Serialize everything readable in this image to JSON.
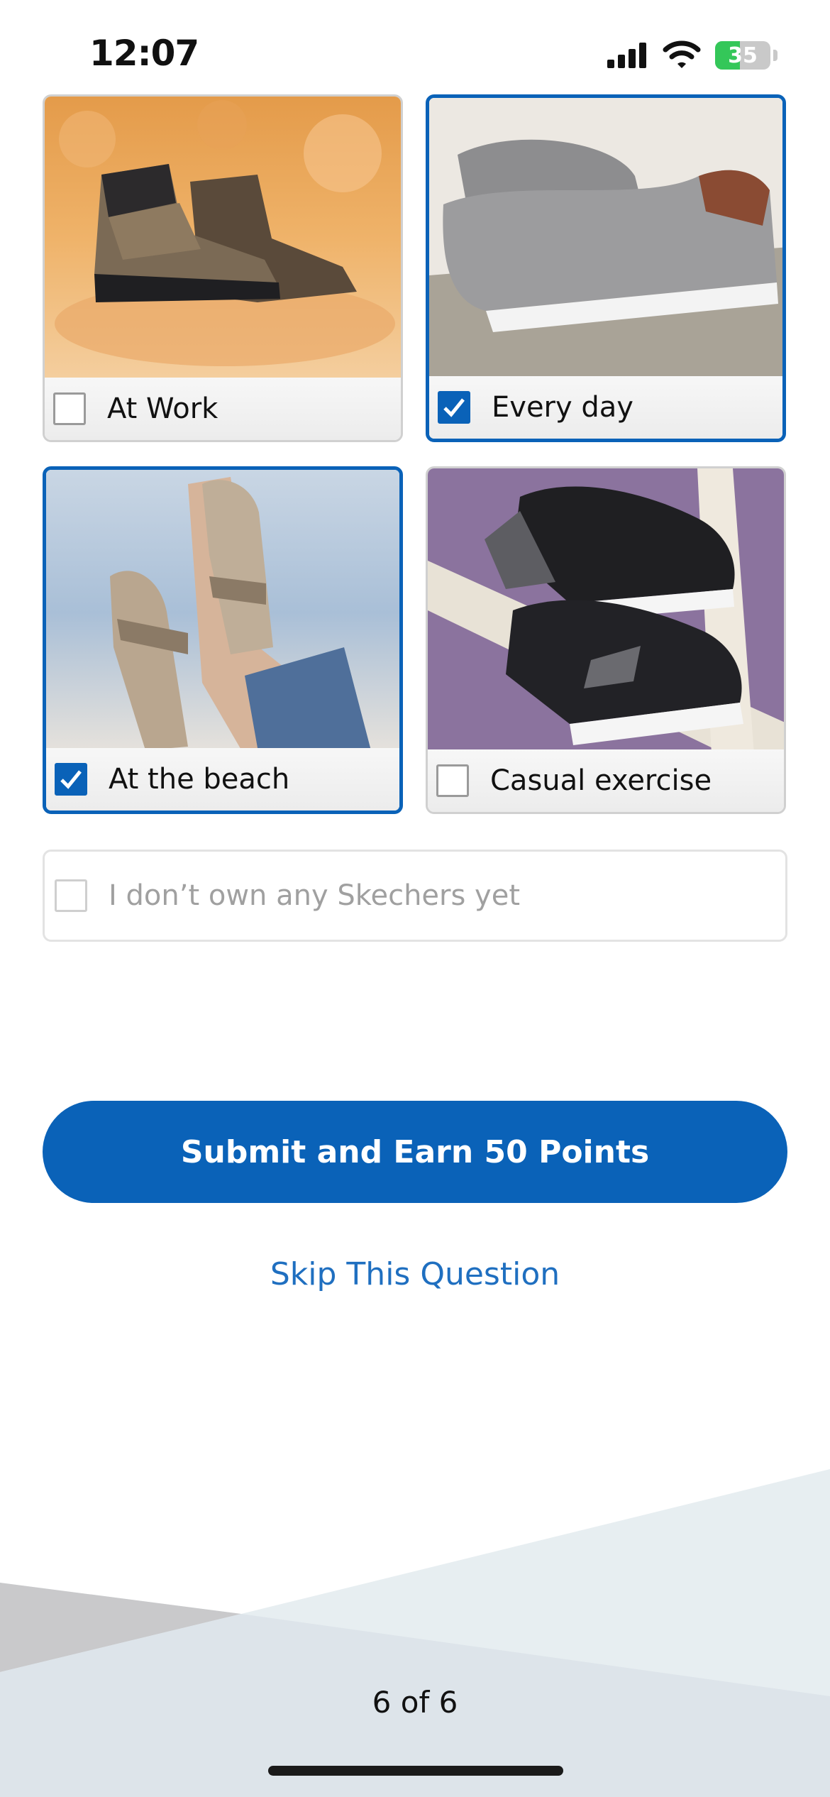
{
  "status_bar": {
    "time": "12:07",
    "battery": "35"
  },
  "options": [
    {
      "label": "At Work",
      "checked": false,
      "image": "hiking boots on autumn leaves"
    },
    {
      "label": "Every day",
      "checked": true,
      "image": "grey slip-on shoes on stone step"
    },
    {
      "label": "At the beach",
      "checked": true,
      "image": "sport sandals against sea"
    },
    {
      "label": "Casual exercise",
      "checked": false,
      "image": "black sneakers on purple background"
    }
  ],
  "none_option": {
    "label": "I don’t own any Skechers yet",
    "checked": false
  },
  "submit_label": "Submit and Earn 50 Points",
  "skip_label": "Skip This Question",
  "pager": "6 of 6",
  "colors": {
    "accent": "#0a62b8",
    "link": "#1f6fc0"
  }
}
